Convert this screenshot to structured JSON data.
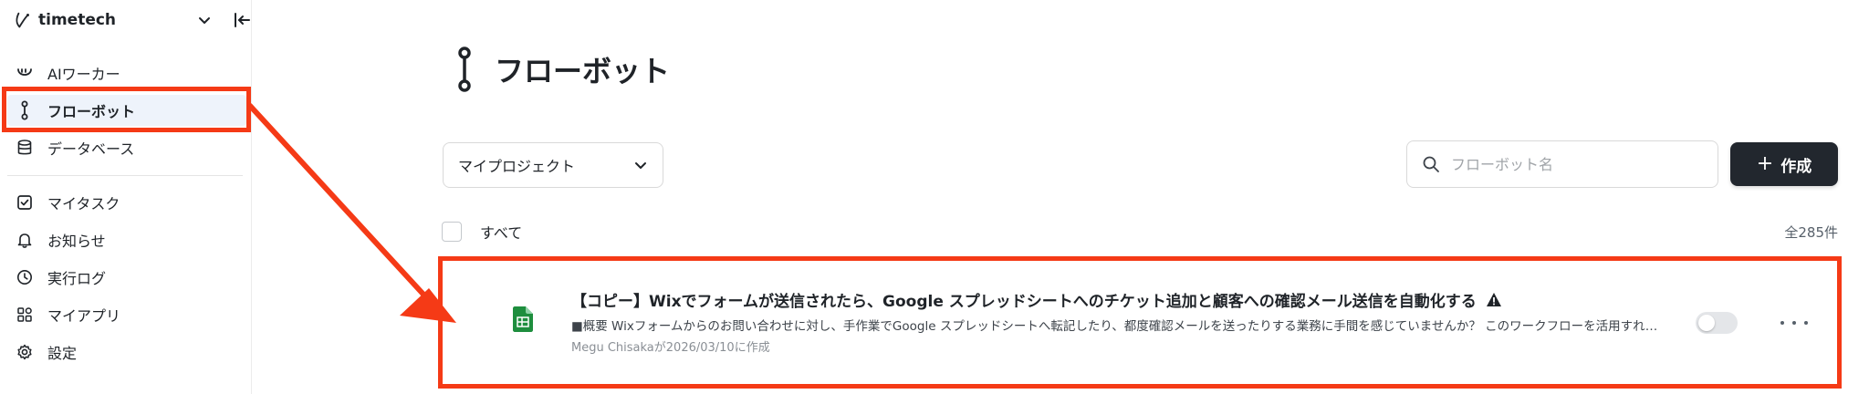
{
  "workspace": {
    "name": "timetech"
  },
  "sidebar": {
    "items": [
      {
        "label": "AIワーカー",
        "icon": "ai-worker-icon"
      },
      {
        "label": "フローボット",
        "icon": "flowbot-icon",
        "active": true
      },
      {
        "label": "データベース",
        "icon": "database-icon"
      },
      {
        "label": "マイタスク",
        "icon": "task-checkbox-icon"
      },
      {
        "label": "お知らせ",
        "icon": "bell-icon"
      },
      {
        "label": "実行ログ",
        "icon": "clock-icon"
      },
      {
        "label": "マイアプリ",
        "icon": "apps-icon"
      },
      {
        "label": "設定",
        "icon": "gear-icon"
      }
    ]
  },
  "page": {
    "title": "フローボット",
    "title_icon": "flowbot-icon"
  },
  "filter": {
    "project_select": "マイプロジェクト"
  },
  "search": {
    "placeholder": "フローボット名"
  },
  "create_button": {
    "label": "作成"
  },
  "list": {
    "select_all_label": "すべて",
    "total": "全285件",
    "items": [
      {
        "title": "【コピー】Wixでフォームが送信されたら、Google スプレッドシートへのチケット追加と顧客への確認メール送信を自動化する",
        "description": "■概要 Wixフォームからのお問い合わせに対し、手作業でGoogle スプレッドシートへ転記したり、都度確認メールを送ったりする業務に手間を感じていませんか？ このワークフローを活用すれば、Wi...",
        "meta": "Megu Chisakaが2026/03/10に作成",
        "app_icon": "google-sheets-icon",
        "warning_icon": "warning-icon",
        "enabled": false
      }
    ]
  },
  "colors": {
    "accent_dark": "#22272e",
    "highlight_red": "#f53a16",
    "sheets_green": "#1e8e3e",
    "active_nav_bg": "#eef3fb"
  }
}
